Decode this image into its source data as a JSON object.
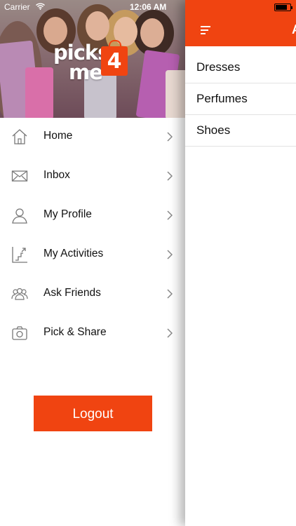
{
  "status_bar": {
    "carrier": "Carrier",
    "time": "12:06 AM"
  },
  "brand": {
    "logo_word_1": "picks",
    "logo_word_2": "me",
    "logo_number": "4",
    "accent_color": "#f04411"
  },
  "drawer": {
    "menu": [
      {
        "label": "Home",
        "icon": "home-icon"
      },
      {
        "label": "Inbox",
        "icon": "envelope-icon"
      },
      {
        "label": "My Profile",
        "icon": "person-icon"
      },
      {
        "label": "My Activities",
        "icon": "activity-stairs-icon"
      },
      {
        "label": "Ask Friends",
        "icon": "group-icon"
      },
      {
        "label": "Pick & Share",
        "icon": "camera-icon"
      }
    ],
    "logout_label": "Logout"
  },
  "main": {
    "nav_title": "A",
    "categories": [
      "Dresses",
      "Perfumes",
      "Shoes"
    ]
  }
}
